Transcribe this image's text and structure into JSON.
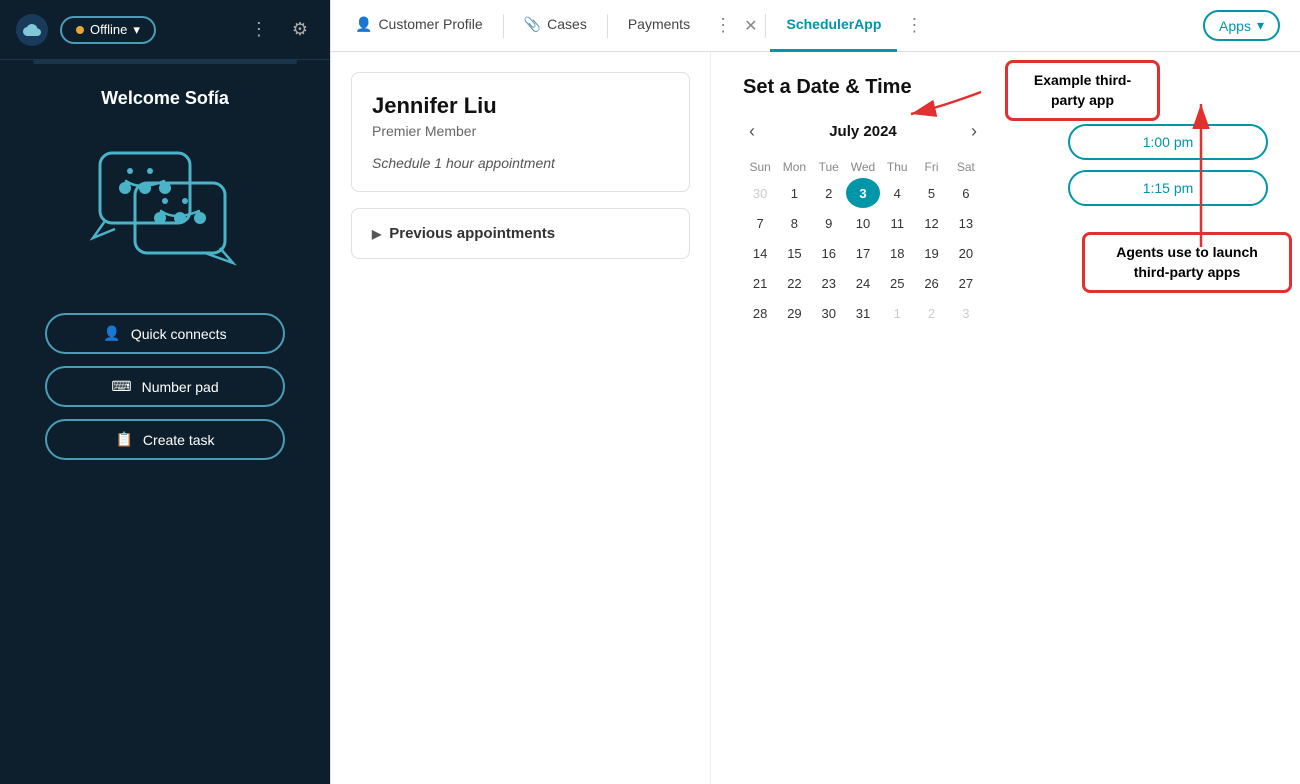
{
  "sidebar": {
    "status": "Offline",
    "welcome": "Welcome Sofía",
    "buttons": [
      {
        "id": "quick-connects",
        "label": "Quick connects",
        "icon": "👤"
      },
      {
        "id": "number-pad",
        "label": "Number pad",
        "icon": "⌨"
      },
      {
        "id": "create-task",
        "label": "Create task",
        "icon": "📋"
      }
    ]
  },
  "tabs": {
    "items": [
      {
        "id": "customer-profile",
        "label": "Customer Profile",
        "icon": "👤",
        "active": false
      },
      {
        "id": "cases",
        "label": "Cases",
        "icon": "📎",
        "active": false
      },
      {
        "id": "payments",
        "label": "Payments",
        "icon": "",
        "active": false
      },
      {
        "id": "scheduler-app",
        "label": "SchedulerApp",
        "icon": "",
        "active": true
      }
    ],
    "apps_label": "Apps"
  },
  "customer": {
    "name": "Jennifer Liu",
    "tier": "Premier Member",
    "appointment_note": "Schedule 1 hour appointment"
  },
  "previous_appointments_label": "Previous appointments",
  "scheduler": {
    "title": "Set a Date & Time",
    "calendar": {
      "month": "July 2024",
      "days_of_week": [
        "Sun",
        "Mon",
        "Tue",
        "Wed",
        "Thu",
        "Fri",
        "Sat"
      ],
      "weeks": [
        [
          {
            "day": 30,
            "other": true
          },
          {
            "day": 1
          },
          {
            "day": 2
          },
          {
            "day": 3,
            "today": true
          },
          {
            "day": 4
          },
          {
            "day": 5
          },
          {
            "day": 6
          }
        ],
        [
          {
            "day": 7
          },
          {
            "day": 8
          },
          {
            "day": 9
          },
          {
            "day": 10
          },
          {
            "day": 11
          },
          {
            "day": 12
          },
          {
            "day": 13
          }
        ],
        [
          {
            "day": 14
          },
          {
            "day": 15
          },
          {
            "day": 16
          },
          {
            "day": 17
          },
          {
            "day": 18
          },
          {
            "day": 19
          },
          {
            "day": 20
          }
        ],
        [
          {
            "day": 21
          },
          {
            "day": 22
          },
          {
            "day": 23
          },
          {
            "day": 24
          },
          {
            "day": 25
          },
          {
            "day": 26
          },
          {
            "day": 27
          }
        ],
        [
          {
            "day": 28
          },
          {
            "day": 29
          },
          {
            "day": 30
          },
          {
            "day": 31
          },
          {
            "day": 1,
            "other": true
          },
          {
            "day": 2,
            "other": true
          },
          {
            "day": 3,
            "other": true
          }
        ]
      ]
    },
    "time_slots": [
      "1:00 pm",
      "1:15 pm"
    ]
  },
  "annotations": {
    "example_app": "Example third-party app",
    "agents_use": "Agents use to launch third-party apps"
  }
}
